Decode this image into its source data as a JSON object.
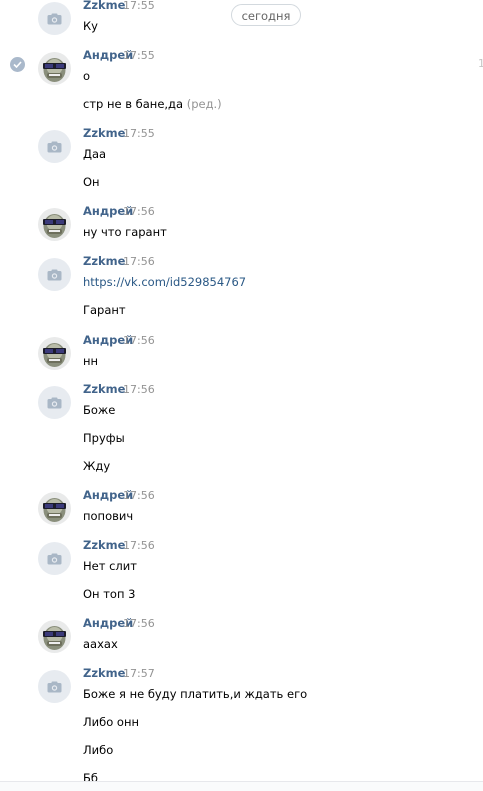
{
  "date_divider": "сегодня",
  "right_mark": "1",
  "messages": [
    {
      "author": "Zzkme",
      "time": "17:55",
      "avatar": "camera-icon",
      "lines": [
        "Ку"
      ]
    },
    {
      "author": "Андрей",
      "time": "17:55",
      "avatar": "andrey-avatar",
      "selected": true,
      "lines": [
        "о",
        "стр не в бане,да"
      ],
      "edited_label": "(ред.)"
    },
    {
      "author": "Zzkme",
      "time": "17:55",
      "avatar": "camera-icon",
      "lines": [
        "Даа",
        "Он"
      ]
    },
    {
      "author": "Андрей",
      "time": "17:56",
      "avatar": "andrey-avatar",
      "lines": [
        "ну что гарант"
      ]
    },
    {
      "author": "Zzkme",
      "time": "17:56",
      "avatar": "camera-icon",
      "lines": [
        "https://vk.com/id529854767",
        "Гарант"
      ]
    },
    {
      "author": "Андрей",
      "time": "17:56",
      "avatar": "andrey-avatar",
      "lines": [
        "нн"
      ]
    },
    {
      "author": "Zzkme",
      "time": "17:56",
      "avatar": "camera-icon",
      "lines": [
        "Боже",
        "Пруфы",
        "Жду"
      ]
    },
    {
      "author": "Андрей",
      "time": "17:56",
      "avatar": "andrey-avatar",
      "lines": [
        "попович"
      ]
    },
    {
      "author": "Zzkme",
      "time": "17:56",
      "avatar": "camera-icon",
      "lines": [
        "Нет слит",
        "Он топ 3"
      ]
    },
    {
      "author": "Андрей",
      "time": "17:56",
      "avatar": "andrey-avatar",
      "lines": [
        "аахах"
      ]
    },
    {
      "author": "Zzkme",
      "time": "17:57",
      "avatar": "camera-icon",
      "lines": [
        "Боже я не буду платить,и ждать его",
        "Либо онн",
        "Либо",
        "Бб"
      ]
    }
  ]
}
